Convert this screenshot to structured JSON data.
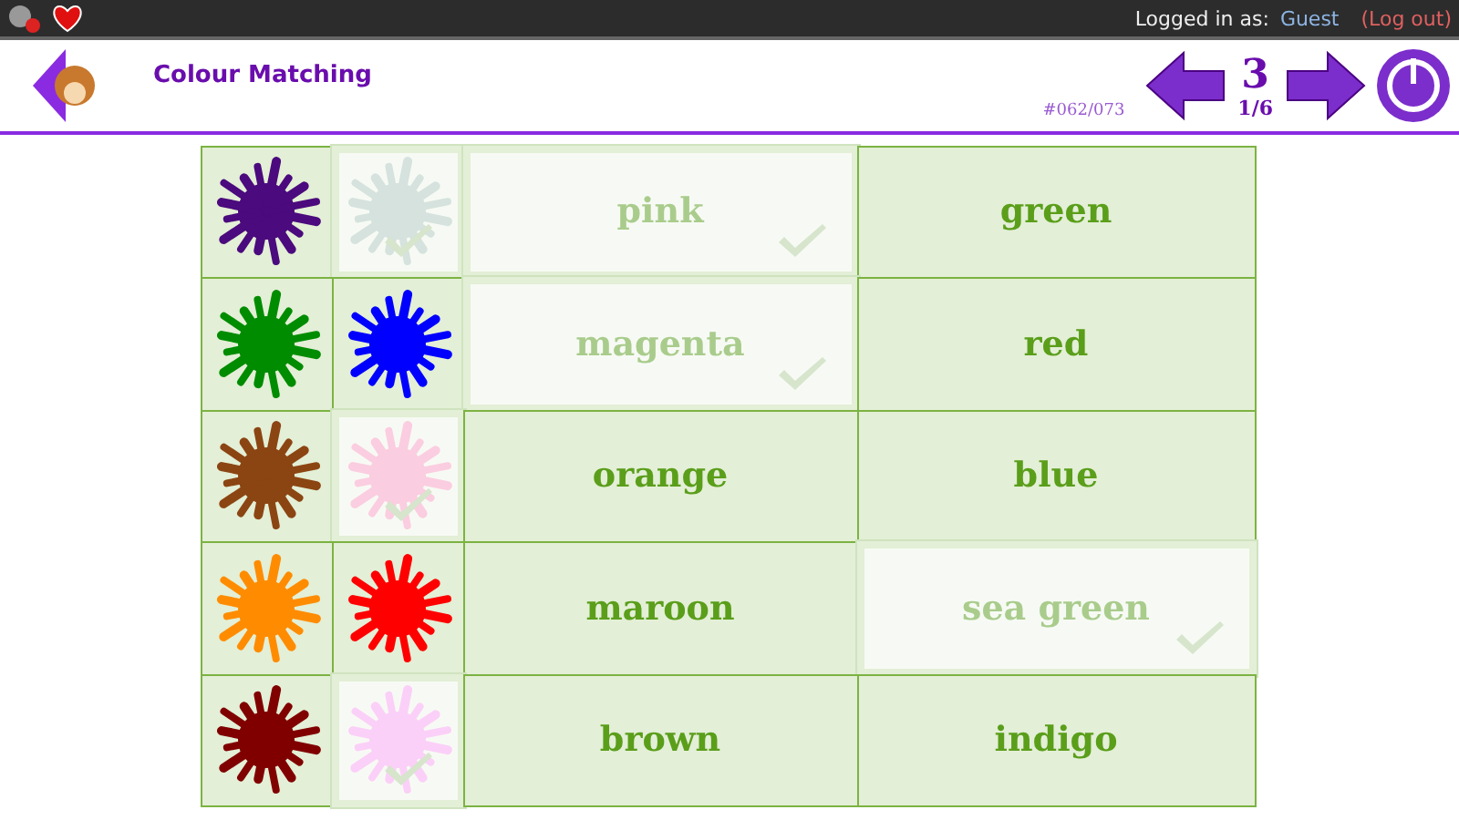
{
  "top_bar": {
    "login_label": "Logged in as:",
    "user": "Guest",
    "logout": "(Log out)"
  },
  "header": {
    "title": "Colour Matching",
    "item_code": "#062/073",
    "score": "3",
    "progress": "1/6"
  },
  "rows": [
    {
      "splat": {
        "color": "#4b0a7d"
      },
      "target": {
        "color": "#d5e2dd",
        "matched": true
      },
      "word": {
        "text": "pink",
        "matched": true
      },
      "answer": {
        "text": "green",
        "matched": false
      }
    },
    {
      "splat": {
        "color": "#008c00"
      },
      "target": {
        "color": "#0000ff",
        "matched": false
      },
      "word": {
        "text": "magenta",
        "matched": true
      },
      "answer": {
        "text": "red",
        "matched": false
      }
    },
    {
      "splat": {
        "color": "#8b4513"
      },
      "target": {
        "color": "#fbcde0",
        "matched": true
      },
      "word": {
        "text": "orange",
        "matched": false
      },
      "answer": {
        "text": "blue",
        "matched": false
      }
    },
    {
      "splat": {
        "color": "#ff8c00"
      },
      "target": {
        "color": "#ff0000",
        "matched": false
      },
      "word": {
        "text": "maroon",
        "matched": false
      },
      "answer": {
        "text": "sea green",
        "matched": true
      }
    },
    {
      "splat": {
        "color": "#800000"
      },
      "target": {
        "color": "#fbd0f8",
        "matched": true
      },
      "word": {
        "text": "brown",
        "matched": false
      },
      "answer": {
        "text": "indigo",
        "matched": false
      }
    }
  ]
}
